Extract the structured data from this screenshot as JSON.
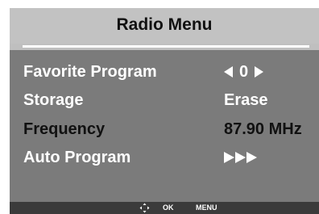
{
  "menu": {
    "title": "Radio Menu",
    "colors": {
      "title_bg": "#c2c2c2",
      "panel_bg": "#7b7b7b",
      "footer_bg": "#3b3b3b",
      "label_white": "#ffffff",
      "label_black": "#111111"
    },
    "rows": [
      {
        "label": "Favorite Program",
        "value": "0",
        "left_icon": "triangle-left-icon",
        "right_icon": "triangle-right-icon"
      },
      {
        "label": "Storage",
        "value": "Erase"
      },
      {
        "label": "Frequency",
        "value": "87.90 MHz"
      },
      {
        "label": "Auto Program",
        "icon": "triple-triangle-right-icon"
      }
    ]
  },
  "footer": {
    "nav_icon": "dpad-arrows-icon",
    "ok_label": "OK",
    "menu_label": "MENU"
  }
}
